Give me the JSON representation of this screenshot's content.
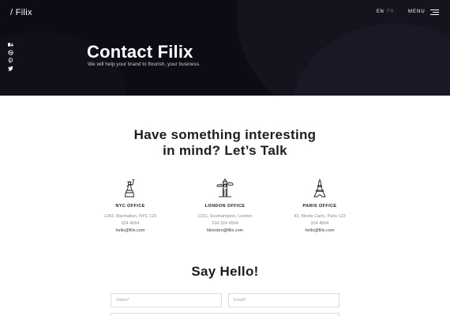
{
  "header": {
    "logo": "/ Filix",
    "lang_en": "EN",
    "lang_fr": "FR",
    "menu_label": "MENU"
  },
  "social": [
    "behance-icon",
    "dribbble-icon",
    "pinterest-icon",
    "twitter-icon"
  ],
  "hero": {
    "title": "Contact Filix",
    "subtitle": "We will help your brand to flourish, your business."
  },
  "intro": {
    "line1": "Have something interesting",
    "line2": "in mind? Let’s Talk"
  },
  "offices": [
    {
      "icon": "statue-of-liberty-icon",
      "title": "NYC OFFICE",
      "address": "1243, Manhattan, NYC 123",
      "phone": "324 4564",
      "email": "hello@filix.com"
    },
    {
      "icon": "big-ben-icon",
      "title": "LONDON OFFICE",
      "address": "1231, Southampton, London",
      "phone": "234 324 4564",
      "email": "hilondon@filix.com"
    },
    {
      "icon": "eiffel-tower-icon",
      "title": "PARIS OFFICE",
      "address": "43, Monte Carlo, Paris 123",
      "phone": "324 4564",
      "email": "hello@filix.com"
    }
  ],
  "form": {
    "heading": "Say Hello!",
    "name_placeholder": "Name*",
    "email_placeholder": "Email*"
  }
}
